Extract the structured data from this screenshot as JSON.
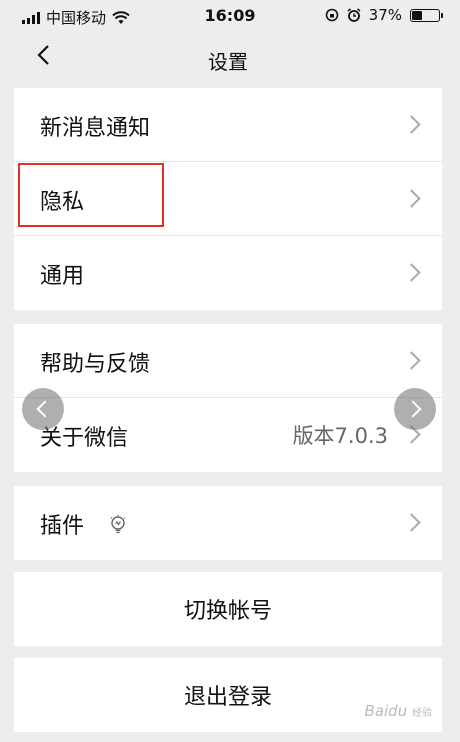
{
  "statusbar": {
    "carrier": "中国移动",
    "time": "16:09",
    "battery_text": "37%",
    "battery_level": 0.37
  },
  "header": {
    "back_label": "<",
    "title": "设置"
  },
  "settings": {
    "group1": [
      {
        "label": "新消息通知"
      },
      {
        "label": "隐私"
      },
      {
        "label": "通用"
      }
    ],
    "group2": [
      {
        "label": "帮助与反馈"
      },
      {
        "label": "关于微信",
        "value": "版本7.0.3"
      }
    ],
    "group3": [
      {
        "label": "插件"
      }
    ]
  },
  "actions": {
    "switch_account": "切换帐号",
    "logout": "退出登录"
  },
  "watermark": {
    "brand": "Baidu",
    "sub": "经验"
  },
  "colors": {
    "highlight": "#e0312e",
    "background": "#ededed"
  }
}
